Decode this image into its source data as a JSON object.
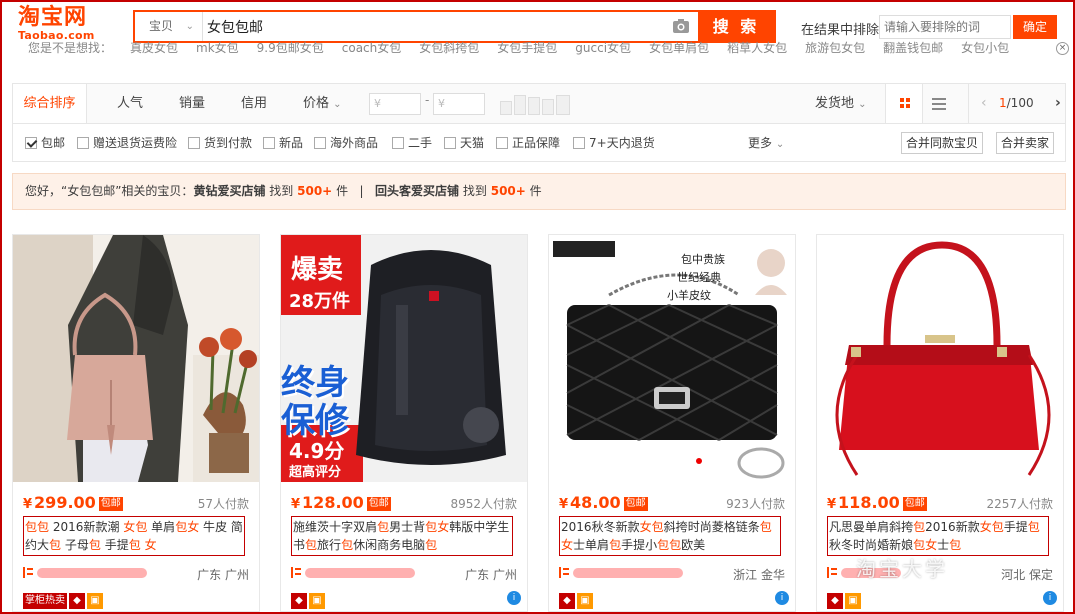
{
  "logo": {
    "cn": "淘宝网",
    "en": "Taobao.com"
  },
  "search": {
    "type": "宝贝",
    "query": "女包包邮",
    "button": "搜 索"
  },
  "exclude": {
    "label": "在结果中排除",
    "placeholder": "请输入要排除的词",
    "button": "确定"
  },
  "hot_words": [
    "您是不是想找：",
    "真皮女包",
    "mk女包",
    "9.9包邮女包",
    "coach女包",
    "女包斜挎包",
    "女包手提包",
    "gucci女包",
    "女包单肩包",
    "稻草人女包",
    "旅游包女包",
    "翻盖钱包邮",
    "女包小包"
  ],
  "sort": {
    "items": [
      "综合排序",
      "人气",
      "销量",
      "信用",
      "价格"
    ],
    "price_from": "¥",
    "price_to": "¥",
    "ship_from": "发货地",
    "page_current": "1",
    "page_total": "/100"
  },
  "filters": {
    "items": [
      "包邮",
      "赠送退货运费险",
      "货到付款",
      "新品",
      "海外商品",
      "二手",
      "天猫",
      "正品保障",
      "7+天内退货"
    ],
    "checked": [
      true,
      false,
      false,
      false,
      false,
      false,
      false,
      false,
      false
    ],
    "more": "更多",
    "merge_same": "合并同款宝贝",
    "merge_seller": "合并卖家"
  },
  "notice": {
    "pre": "您好，“女包包邮”相关的宝贝：",
    "shop1": "黄钻爱买店铺",
    "found1": "找到",
    "count1": "500+",
    "unit1": "件",
    "sep": "|",
    "shop2": "回头客爱买店铺",
    "found2": "找到",
    "count2": "500+",
    "unit2": "件"
  },
  "products": [
    {
      "price": "299.00",
      "yen": "¥",
      "tag": "包邮",
      "paid": "57人付款",
      "title": "包包 2016新款潮 女包 单肩包女 牛皮 简约大包 子母包 手提包 女",
      "location": "广东 广州",
      "badge": "掌柜热卖"
    },
    {
      "price": "128.00",
      "yen": "¥",
      "tag": "包邮",
      "paid": "8952人付款",
      "title": "施维茨十字双肩包男士背包女韩版中学生书包旅行包休闲商务电脑包",
      "location": "广东 广州",
      "promo1": "爆卖",
      "promo2": "28万件",
      "promo3": "终身",
      "promo4": "保修",
      "promo5": "4.9分",
      "promo6": "超高评分"
    },
    {
      "price": "48.00",
      "yen": "¥",
      "tag": "包邮",
      "paid": "923人付款",
      "title": "2016秋冬新款女包斜挎时尚菱格链条包女士单肩包手提小包包欧美",
      "location": "浙江 金华",
      "promo1": "包中贵族",
      "promo2": "世纪经典",
      "promo3": "小羊皮纹"
    },
    {
      "price": "118.00",
      "yen": "¥",
      "tag": "包邮",
      "paid": "2257人付款",
      "title": "凡思曼单肩斜挎包2016新款女包手提包秋冬时尚婚新娘包女士包",
      "location": "河北 保定"
    }
  ],
  "watermark": "淘宝大学",
  "colors": {
    "accent": "#ff4400",
    "frame": "#c40000"
  }
}
